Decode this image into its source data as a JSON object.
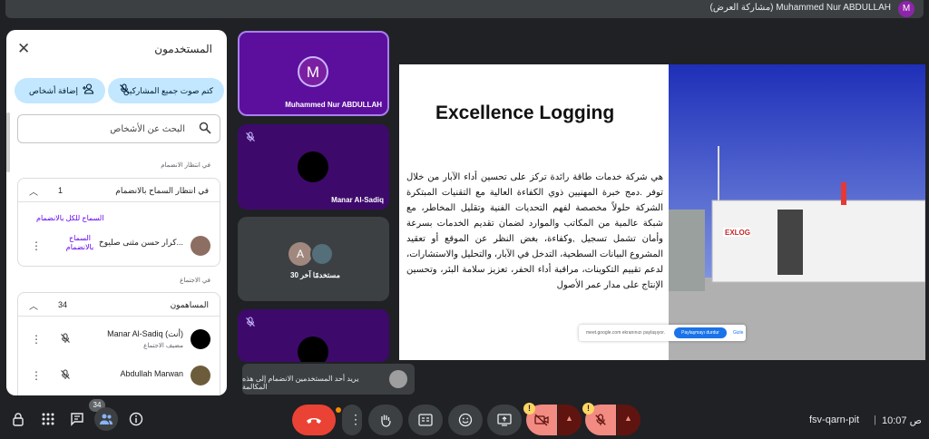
{
  "topbar": {
    "presenter": "(مشاركة العرض) Muhammed Nur ABDULLAH",
    "avatar_initial": "M"
  },
  "people_panel": {
    "title": "المستخدمون",
    "mute_all": "كتم صوت جميع المشاركين",
    "add_people": "إضافة أشخاص",
    "search_placeholder": "البحث عن الأشخاص",
    "waiting_section_label": "في انتظار الانضمام",
    "waiting_card": {
      "title": "في انتظار السماح بالانضمام",
      "count": "1",
      "admit_all": "السماح للكل بالانضمام",
      "person_name": "كرار حسن مثنى صليوخ...",
      "admit": "السماح بالانضمام"
    },
    "meeting_section_label": "في الاجتماع",
    "contributors_card": {
      "title": "المساهمون",
      "count": "34",
      "people": [
        {
          "name": "Manar Al-Sadiq (أنت)",
          "role": "مضيف الاجتماع"
        },
        {
          "name": "Abdullah Marwan",
          "role": ""
        }
      ]
    }
  },
  "tiles": [
    {
      "initial": "M",
      "name": "Muhammed Nur ABDULLAH"
    },
    {
      "name": "Manar Al-Sadiq"
    },
    {
      "initial": "A",
      "name": "30 مستخدمًا آخر"
    }
  ],
  "slide": {
    "title": "Excellence Logging",
    "body": "هي شركة خدمات طاقة رائدة تركز على تحسين أداء الآبار من خلال توفر .دمج خبرة المهنيين ذوي الكفاءة العالية مع التقنيات المبتكرة الشركة حلولاً مخصصة لفهم التحديات الفنية وتقليل المخاطر، مع شبكة عالمية من المكاتب والموارد لضمان تقديم الخدمات بسرعة وأمان تشمل تسجيل ,وكفاءة، بغض النظر عن الموقع أو تعقيد المشروع البيانات السطحية، التدخل في الآبار، والتحليل والاستشارات، لدعم تقييم التكوينات، مراقبة أداء الحفر، تعزيز سلامة البئر، وتحسين الإنتاج على مدار عمر الأصول",
    "container_logo": "EXLOG",
    "share_banner": {
      "text": "meet.google.com ekranınızı paylaşıyor.",
      "stop_button": "Paylaşmayı durdur",
      "hide": "Gizle"
    }
  },
  "toast": {
    "text": "يريد أحد المستخدمين الانضمام إلى هذه المكالمة"
  },
  "bottom_bar": {
    "people_count_badge": "34",
    "warn_mark": "!",
    "meeting_code": "fsv-qarn-pit",
    "separator": "|",
    "time": "10:07 ص"
  },
  "colors": {
    "accent_purple": "#5b0f9c",
    "end_call": "#ea4335",
    "mute_red": "#f28b82",
    "link": "#6200ee"
  }
}
